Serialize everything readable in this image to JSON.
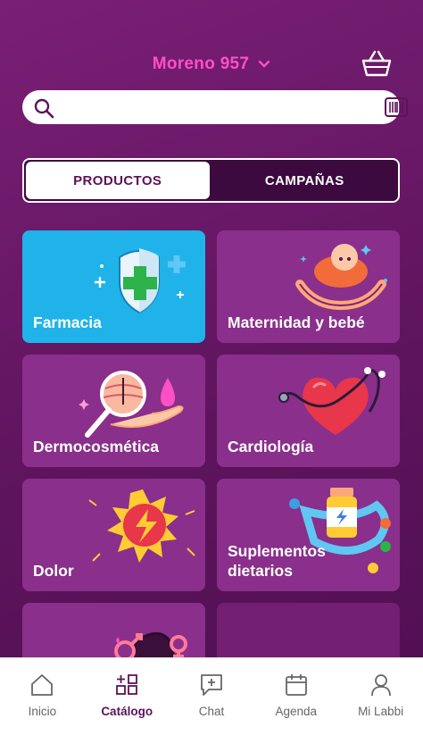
{
  "header": {
    "location_label": "Moreno 957",
    "basket_icon": "basket-icon",
    "chevron_icon": "chevron-down-icon"
  },
  "search": {
    "placeholder": "",
    "search_icon": "search-icon",
    "barcode_icon": "barcode-icon"
  },
  "tabs": [
    {
      "label": "PRODUCTOS",
      "active": true
    },
    {
      "label": "CAMPAÑAS",
      "active": false
    }
  ],
  "categories": [
    {
      "label": "Farmacia",
      "icon": "pharmacy-shield-icon"
    },
    {
      "label": "Maternidad y bebé",
      "icon": "baby-hands-icon"
    },
    {
      "label": "Dermocosmética",
      "icon": "skin-magnifier-icon"
    },
    {
      "label": "Cardiología",
      "icon": "heart-stethoscope-icon"
    },
    {
      "label": "Dolor",
      "icon": "pain-lightning-icon"
    },
    {
      "label": "Suplementos",
      "label_line2": "dietarios",
      "icon": "supplements-bottle-icon"
    },
    {
      "label": "",
      "icon": "gender-symbols-icon"
    },
    {
      "label": "",
      "icon": ""
    }
  ],
  "bottom_nav": [
    {
      "label": "Inicio",
      "icon": "home-icon",
      "active": false
    },
    {
      "label": "Catálogo",
      "icon": "catalog-grid-icon",
      "active": true
    },
    {
      "label": "Chat",
      "icon": "chat-icon",
      "active": false
    },
    {
      "label": "Agenda",
      "icon": "calendar-icon",
      "active": false
    },
    {
      "label": "Mi Labbi",
      "icon": "user-icon",
      "active": false
    }
  ],
  "colors": {
    "background": "#6a1868",
    "accent_pink": "#ff4fc6",
    "card": "#8a2f8b",
    "card_highlight": "#1fb3ea",
    "nav_active": "#5b1359"
  }
}
